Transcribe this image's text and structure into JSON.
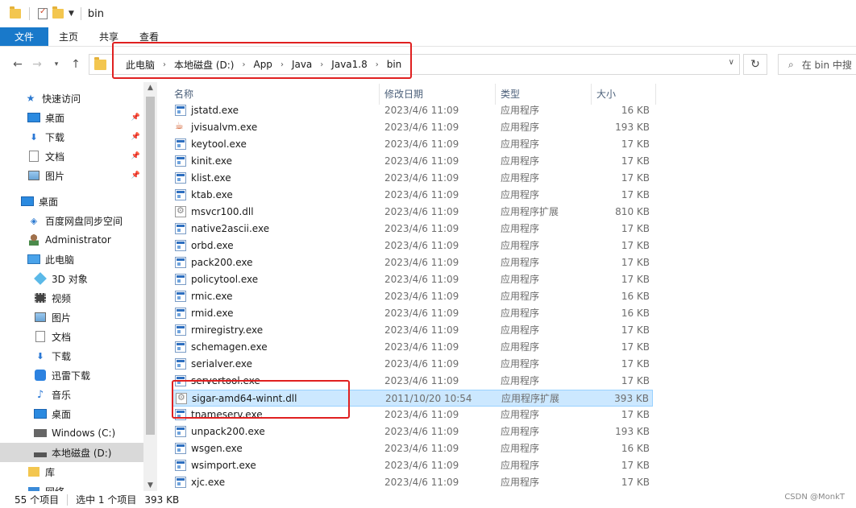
{
  "window": {
    "title": "bin"
  },
  "ribbon": {
    "tabs": [
      "文件",
      "主页",
      "共享",
      "查看"
    ]
  },
  "address": {
    "crumbs": [
      "此电脑",
      "本地磁盘 (D:)",
      "App",
      "Java",
      "Java1.8",
      "bin"
    ],
    "search_placeholder": "在 bin 中搜"
  },
  "sidebar": {
    "items": [
      {
        "label": "快速访问",
        "icon": "star-icon",
        "pinned": false
      },
      {
        "label": "桌面",
        "icon": "desktop-icon",
        "pinned": true
      },
      {
        "label": "下载",
        "icon": "download-icon",
        "pinned": true
      },
      {
        "label": "文档",
        "icon": "document-icon",
        "pinned": true
      },
      {
        "label": "图片",
        "icon": "pictures-icon",
        "pinned": true
      },
      {
        "label": "桌面",
        "icon": "desktop-icon",
        "pinned": false
      },
      {
        "label": "百度网盘同步空间",
        "icon": "baidu-netdisk-icon",
        "pinned": false
      },
      {
        "label": "Administrator",
        "icon": "user-icon",
        "pinned": false
      },
      {
        "label": "此电脑",
        "icon": "computer-icon",
        "pinned": false
      },
      {
        "label": "3D 对象",
        "icon": "3d-objects-icon",
        "pinned": false
      },
      {
        "label": "视频",
        "icon": "video-icon",
        "pinned": false
      },
      {
        "label": "图片",
        "icon": "pictures-icon",
        "pinned": false
      },
      {
        "label": "文档",
        "icon": "document-icon",
        "pinned": false
      },
      {
        "label": "下载",
        "icon": "download-icon",
        "pinned": false
      },
      {
        "label": "迅雷下载",
        "icon": "xunlei-icon",
        "pinned": false
      },
      {
        "label": "音乐",
        "icon": "music-icon",
        "pinned": false
      },
      {
        "label": "桌面",
        "icon": "desktop-icon",
        "pinned": false
      },
      {
        "label": "Windows (C:)",
        "icon": "windows-drive-icon",
        "pinned": false
      },
      {
        "label": "本地磁盘 (D:)",
        "icon": "drive-icon",
        "pinned": false
      },
      {
        "label": "库",
        "icon": "library-icon",
        "pinned": false
      },
      {
        "label": "网络",
        "icon": "network-icon",
        "pinned": false
      }
    ]
  },
  "columns": {
    "name": "名称",
    "date": "修改日期",
    "type": "类型",
    "size": "大小"
  },
  "files": [
    {
      "name": "jstatd.exe",
      "date": "2023/4/6 11:09",
      "type": "应用程序",
      "size": "16 KB",
      "icon": "exe"
    },
    {
      "name": "jvisualvm.exe",
      "date": "2023/4/6 11:09",
      "type": "应用程序",
      "size": "193 KB",
      "icon": "java"
    },
    {
      "name": "keytool.exe",
      "date": "2023/4/6 11:09",
      "type": "应用程序",
      "size": "17 KB",
      "icon": "exe"
    },
    {
      "name": "kinit.exe",
      "date": "2023/4/6 11:09",
      "type": "应用程序",
      "size": "17 KB",
      "icon": "exe"
    },
    {
      "name": "klist.exe",
      "date": "2023/4/6 11:09",
      "type": "应用程序",
      "size": "17 KB",
      "icon": "exe"
    },
    {
      "name": "ktab.exe",
      "date": "2023/4/6 11:09",
      "type": "应用程序",
      "size": "17 KB",
      "icon": "exe"
    },
    {
      "name": "msvcr100.dll",
      "date": "2023/4/6 11:09",
      "type": "应用程序扩展",
      "size": "810 KB",
      "icon": "dll"
    },
    {
      "name": "native2ascii.exe",
      "date": "2023/4/6 11:09",
      "type": "应用程序",
      "size": "17 KB",
      "icon": "exe"
    },
    {
      "name": "orbd.exe",
      "date": "2023/4/6 11:09",
      "type": "应用程序",
      "size": "17 KB",
      "icon": "exe"
    },
    {
      "name": "pack200.exe",
      "date": "2023/4/6 11:09",
      "type": "应用程序",
      "size": "17 KB",
      "icon": "exe"
    },
    {
      "name": "policytool.exe",
      "date": "2023/4/6 11:09",
      "type": "应用程序",
      "size": "17 KB",
      "icon": "exe"
    },
    {
      "name": "rmic.exe",
      "date": "2023/4/6 11:09",
      "type": "应用程序",
      "size": "16 KB",
      "icon": "exe"
    },
    {
      "name": "rmid.exe",
      "date": "2023/4/6 11:09",
      "type": "应用程序",
      "size": "16 KB",
      "icon": "exe"
    },
    {
      "name": "rmiregistry.exe",
      "date": "2023/4/6 11:09",
      "type": "应用程序",
      "size": "17 KB",
      "icon": "exe"
    },
    {
      "name": "schemagen.exe",
      "date": "2023/4/6 11:09",
      "type": "应用程序",
      "size": "17 KB",
      "icon": "exe"
    },
    {
      "name": "serialver.exe",
      "date": "2023/4/6 11:09",
      "type": "应用程序",
      "size": "17 KB",
      "icon": "exe"
    },
    {
      "name": "servertool.exe",
      "date": "2023/4/6 11:09",
      "type": "应用程序",
      "size": "17 KB",
      "icon": "exe"
    },
    {
      "name": "sigar-amd64-winnt.dll",
      "date": "2011/10/20 10:54",
      "type": "应用程序扩展",
      "size": "393 KB",
      "icon": "dll",
      "selected": true
    },
    {
      "name": "tnameserv.exe",
      "date": "2023/4/6 11:09",
      "type": "应用程序",
      "size": "17 KB",
      "icon": "exe"
    },
    {
      "name": "unpack200.exe",
      "date": "2023/4/6 11:09",
      "type": "应用程序",
      "size": "193 KB",
      "icon": "exe"
    },
    {
      "name": "wsgen.exe",
      "date": "2023/4/6 11:09",
      "type": "应用程序",
      "size": "16 KB",
      "icon": "exe"
    },
    {
      "name": "wsimport.exe",
      "date": "2023/4/6 11:09",
      "type": "应用程序",
      "size": "17 KB",
      "icon": "exe"
    },
    {
      "name": "xjc.exe",
      "date": "2023/4/6 11:09",
      "type": "应用程序",
      "size": "17 KB",
      "icon": "exe"
    }
  ],
  "status": {
    "count": "55 个项目",
    "selection": "选中 1 个项目",
    "selection_size": "393 KB"
  },
  "watermark": "CSDN @MonkT",
  "colors": {
    "accent": "#1979ca",
    "highlight": "#e02020",
    "selected_row": "#cce8ff"
  }
}
